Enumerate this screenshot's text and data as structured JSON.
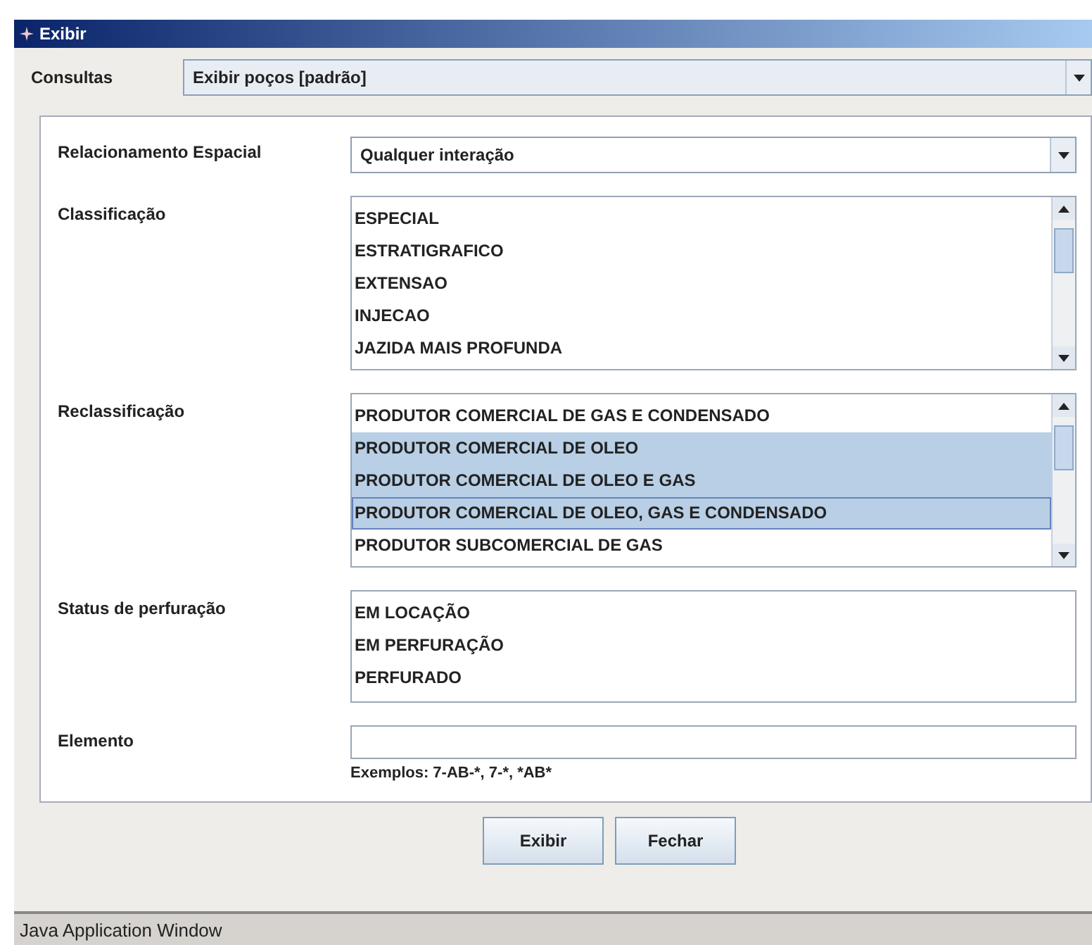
{
  "window": {
    "title": "Exibir"
  },
  "consultas": {
    "label": "Consultas",
    "value": "Exibir poços [padrão]"
  },
  "form": {
    "fields": [
      {
        "kind": "combo",
        "label": "Relacionamento Espacial",
        "value": "Qualquer interação"
      },
      {
        "kind": "list",
        "label": "Classificação",
        "scrollbar": true,
        "items": [
          {
            "text": "ESPECIAL",
            "selected": false,
            "focused": false
          },
          {
            "text": "ESTRATIGRAFICO",
            "selected": false,
            "focused": false
          },
          {
            "text": "EXTENSAO",
            "selected": false,
            "focused": false
          },
          {
            "text": "INJECAO",
            "selected": false,
            "focused": false
          },
          {
            "text": "JAZIDA MAIS PROFUNDA",
            "selected": false,
            "focused": false
          }
        ]
      },
      {
        "kind": "list",
        "label": "Reclassificação",
        "scrollbar": true,
        "items": [
          {
            "text": "PRODUTOR COMERCIAL DE GAS E CONDENSADO",
            "selected": false,
            "focused": false
          },
          {
            "text": "PRODUTOR COMERCIAL DE OLEO",
            "selected": true,
            "focused": false
          },
          {
            "text": "PRODUTOR COMERCIAL DE OLEO E GAS",
            "selected": true,
            "focused": false
          },
          {
            "text": "PRODUTOR COMERCIAL DE OLEO, GAS E CONDENSADO",
            "selected": true,
            "focused": true
          },
          {
            "text": "PRODUTOR SUBCOMERCIAL DE GAS",
            "selected": false,
            "focused": false
          }
        ]
      },
      {
        "kind": "list",
        "label": "Status de perfuração",
        "scrollbar": false,
        "items": [
          {
            "text": "EM LOCAÇÃO",
            "selected": false,
            "focused": false
          },
          {
            "text": "EM PERFURAÇÃO",
            "selected": false,
            "focused": false
          },
          {
            "text": "PERFURADO",
            "selected": false,
            "focused": false
          }
        ]
      },
      {
        "kind": "text",
        "label": "Elemento",
        "hint": "Exemplos: 7-AB-*, 7-*, *AB*"
      }
    ]
  },
  "buttons": [
    "Exibir",
    "Fechar"
  ],
  "status_bar": "Java Application Window"
}
